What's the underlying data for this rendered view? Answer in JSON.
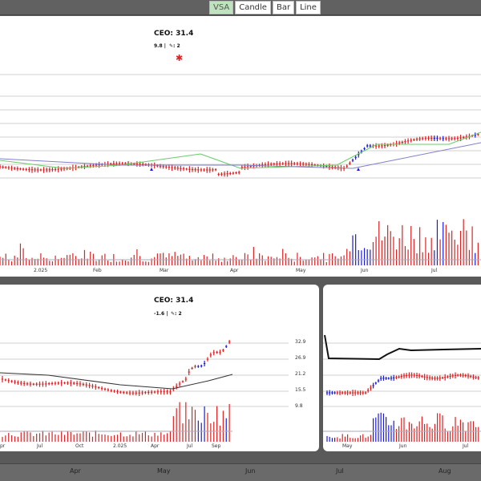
{
  "toolbar": {
    "buttons": [
      {
        "label": "VSA",
        "active": true
      },
      {
        "label": "Candle"
      },
      {
        "label": "Bar"
      },
      {
        "label": "Line"
      }
    ]
  },
  "top_chart": {
    "ceo_label": "CEO: 31.4",
    "sub_value": "9.8 |",
    "sub_count": ": 2",
    "x_labels": [
      "2.025",
      "Feb",
      "Mar",
      "Apr",
      "May",
      "Jun",
      "Jul"
    ]
  },
  "bottom_left_chart": {
    "ceo_label": "CEO: 31.4",
    "sub_value": "-1.6 |",
    "sub_count": ": 2",
    "price_labels": [
      "32.9",
      "26.9",
      "21.2",
      "15.5",
      "9.8"
    ],
    "x_labels": [
      "pr",
      "Jul",
      "Oct",
      "2.025",
      "Apr",
      "Jul",
      "Sep"
    ]
  },
  "bottom_right_chart": {
    "x_labels": [
      "May",
      "Jun",
      "Jul"
    ]
  },
  "timeline": {
    "labels": [
      "Apr",
      "May",
      "Jun",
      "Jul",
      "Aug"
    ]
  },
  "colors": {
    "up": "#1a1adf",
    "down": "#e02020",
    "ma_fast": "#66cc66",
    "ma_slow": "#8080cc",
    "grid": "#d0d0d0"
  }
}
